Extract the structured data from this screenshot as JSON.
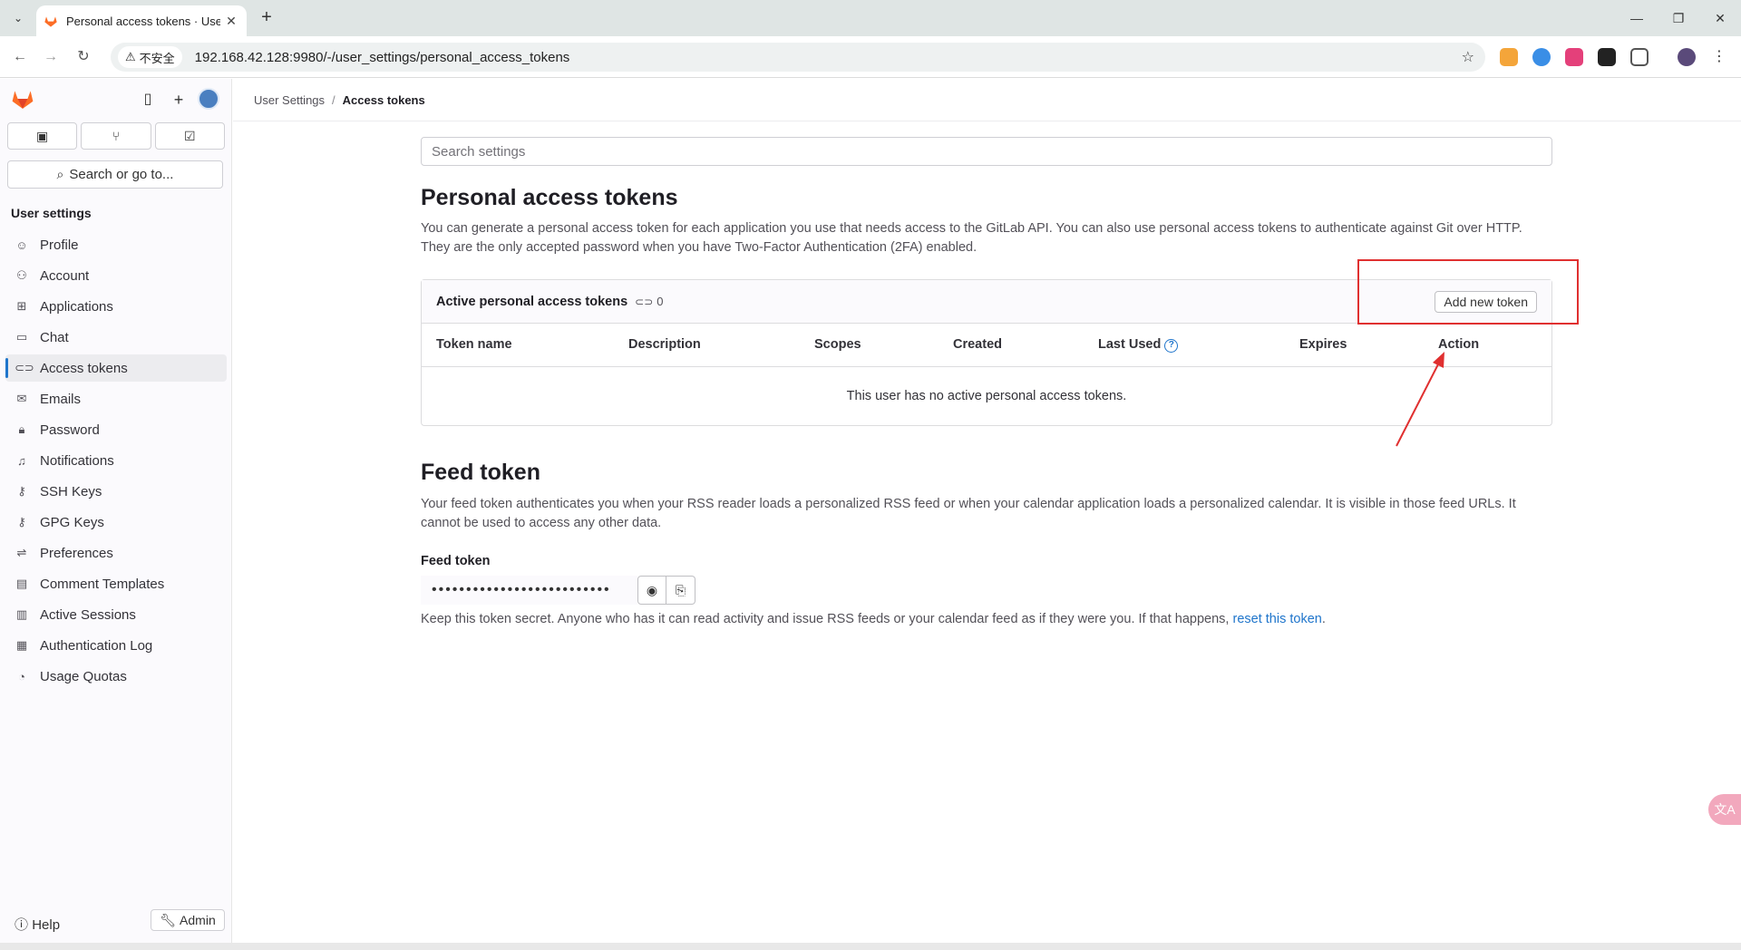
{
  "browser": {
    "tab_title": "Personal access tokens · User Settings",
    "security_label": "不安全",
    "url": "192.168.42.128:9980/-/user_settings/personal_access_tokens"
  },
  "sidebar": {
    "search_label": "Search or go to...",
    "section_title": "User settings",
    "items": [
      {
        "label": "Profile",
        "icon": "profile-icon"
      },
      {
        "label": "Account",
        "icon": "account-icon"
      },
      {
        "label": "Applications",
        "icon": "applications-icon"
      },
      {
        "label": "Chat",
        "icon": "chat-icon"
      },
      {
        "label": "Access tokens",
        "icon": "token-icon",
        "active": true
      },
      {
        "label": "Emails",
        "icon": "mail-icon"
      },
      {
        "label": "Password",
        "icon": "lock-icon"
      },
      {
        "label": "Notifications",
        "icon": "bell-icon"
      },
      {
        "label": "SSH Keys",
        "icon": "key-icon"
      },
      {
        "label": "GPG Keys",
        "icon": "key-icon"
      },
      {
        "label": "Preferences",
        "icon": "preferences-icon"
      },
      {
        "label": "Comment Templates",
        "icon": "comment-icon"
      },
      {
        "label": "Active Sessions",
        "icon": "monitor-icon"
      },
      {
        "label": "Authentication Log",
        "icon": "log-icon"
      },
      {
        "label": "Usage Quotas",
        "icon": "quota-icon"
      }
    ],
    "help_label": "Help",
    "admin_label": "Admin"
  },
  "breadcrumb": {
    "parent": "User Settings",
    "separator": "/",
    "current": "Access tokens"
  },
  "main": {
    "search_placeholder": "Search settings",
    "pat": {
      "title": "Personal access tokens",
      "description": "You can generate a personal access token for each application you use that needs access to the GitLab API. You can also use personal access tokens to authenticate against Git over HTTP. They are the only accepted password when you have Two-Factor Authentication (2FA) enabled.",
      "card_title": "Active personal access tokens",
      "count": "0",
      "add_button": "Add new token",
      "columns": [
        "Token name",
        "Description",
        "Scopes",
        "Created",
        "Last Used",
        "Expires",
        "Action"
      ],
      "empty_message": "This user has no active personal access tokens."
    },
    "feed": {
      "title": "Feed token",
      "description": "Your feed token authenticates you when your RSS reader loads a personalized RSS feed or when your calendar application loads a personalized calendar. It is visible in those feed URLs. It cannot be used to access any other data.",
      "label": "Feed token",
      "masked_value": "••••••••••••••••••••••••••",
      "help_text": "Keep this token secret. Anyone who has it can read activity and issue RSS feeds or your calendar feed as if they were you. If that happens,",
      "reset_link": "reset this token",
      "help_suffix": "."
    }
  },
  "colors": {
    "accent": "#1f75cb",
    "annotation": "#e03030",
    "gitlab_orange": "#fc6d26"
  }
}
